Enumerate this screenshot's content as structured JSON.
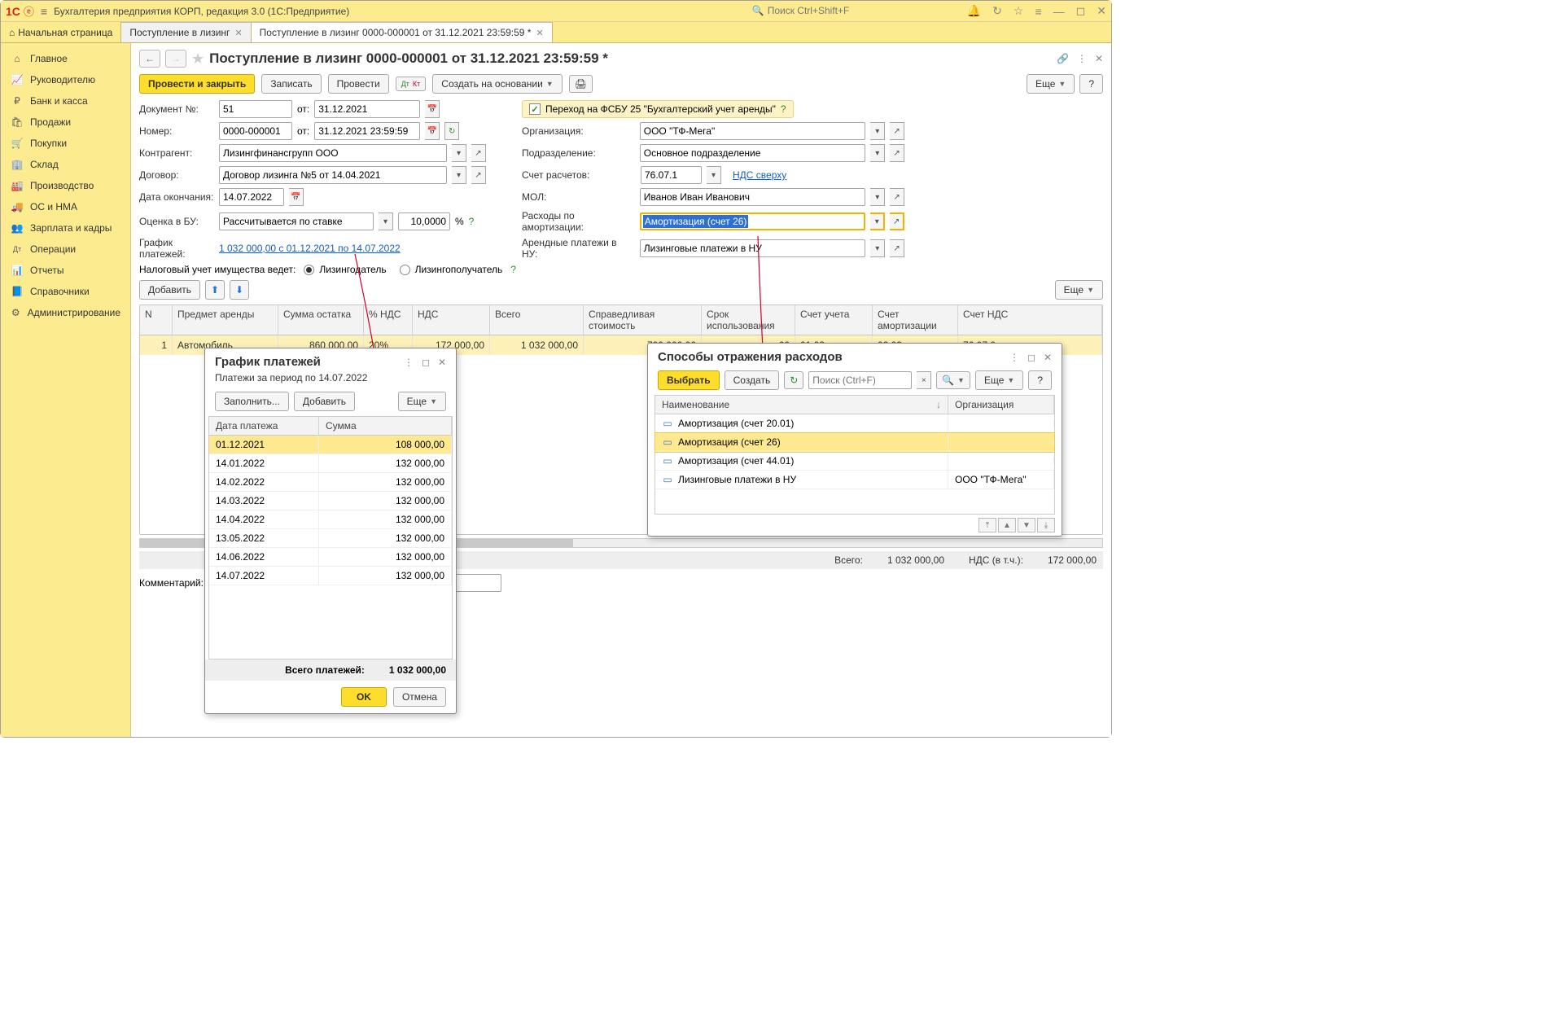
{
  "app": {
    "title": "Бухгалтерия предприятия КОРП, редакция 3.0  (1С:Предприятие)",
    "search_placeholder": "Поиск Ctrl+Shift+F"
  },
  "tabs": {
    "home": "Начальная страница",
    "t1": "Поступление в лизинг",
    "t2": "Поступление в лизинг 0000-000001 от 31.12.2021 23:59:59 *"
  },
  "sidebar": [
    {
      "icon": "⌂",
      "label": "Главное"
    },
    {
      "icon": "📈",
      "label": "Руководителю"
    },
    {
      "icon": "₽",
      "label": "Банк и касса"
    },
    {
      "icon": "🛍",
      "label": "Продажи"
    },
    {
      "icon": "🛒",
      "label": "Покупки"
    },
    {
      "icon": "🏢",
      "label": "Склад"
    },
    {
      "icon": "🏭",
      "label": "Производство"
    },
    {
      "icon": "🚚",
      "label": "ОС и НМА"
    },
    {
      "icon": "👥",
      "label": "Зарплата и кадры"
    },
    {
      "icon": "Дт",
      "label": "Операции"
    },
    {
      "icon": "📊",
      "label": "Отчеты"
    },
    {
      "icon": "📘",
      "label": "Справочники"
    },
    {
      "icon": "⚙",
      "label": "Администрирование"
    }
  ],
  "doc": {
    "title": "Поступление в лизинг 0000-000001 от 31.12.2021 23:59:59 *",
    "post_close": "Провести и закрыть",
    "save": "Записать",
    "post": "Провести",
    "create_based": "Создать на основании",
    "more": "Еще",
    "help": "?"
  },
  "fields": {
    "doc_no_lbl": "Документ №:",
    "doc_no": "51",
    "ot": "от:",
    "doc_date": "31.12.2021",
    "fsbu": "Переход на ФСБУ 25 \"Бухгалтерский учет аренды\"",
    "number_lbl": "Номер:",
    "number": "0000-000001",
    "datetime": "31.12.2021 23:59:59",
    "org_lbl": "Организация:",
    "org": "ООО \"ТФ-Мега\"",
    "contractor_lbl": "Контрагент:",
    "contractor": "Лизингфинансгрупп ООО",
    "division_lbl": "Подразделение:",
    "division": "Основное подразделение",
    "contract_lbl": "Договор:",
    "contract": "Договор лизинга №5 от 14.04.2021",
    "account_lbl": "Счет расчетов:",
    "account": "76.07.1",
    "vat_link": "НДС сверху",
    "end_date_lbl": "Дата окончания:",
    "end_date": "14.07.2022",
    "mol_lbl": "МОЛ:",
    "mol": "Иванов Иван Иванович",
    "eval_lbl": "Оценка в БУ:",
    "eval": "Рассчитывается по ставке",
    "rate": "10,0000",
    "pct": "%",
    "amort_lbl": "Расходы по амортизации:",
    "amort": "Амортизация (счет 26)",
    "schedule_lbl": "График платежей:",
    "schedule_link": "1 032 000,00 с 01.12.2021 по 14.07.2022",
    "rent_nu_lbl": "Арендные платежи в НУ:",
    "rent_nu": "Лизинговые платежи в НУ",
    "tax_account_lbl": "Налоговый учет имущества ведет:",
    "lessor": "Лизингодатель",
    "lessee": "Лизингополучатель",
    "add_btn": "Добавить",
    "comment_lbl": "Комментарий:"
  },
  "table": {
    "headers": [
      "N",
      "Предмет аренды",
      "Сумма остатка",
      "% НДС",
      "НДС",
      "Всего",
      "Справедливая стоимость",
      "Срок использования",
      "Счет учета",
      "Счет амортизации",
      "Счет НДС"
    ],
    "row": {
      "n": "1",
      "item": "Автомобиль",
      "sum": "860 000,00",
      "vat_pct": "20%",
      "vat": "172 000,00",
      "total": "1 032 000,00",
      "fair": "700 000,00",
      "term": "60",
      "acc": "01.03",
      "amort_acc": "02.03",
      "vat_acc": "76.07.9"
    }
  },
  "totals": {
    "total_lbl": "Всего:",
    "total": "1 032 000,00",
    "vat_lbl": "НДС (в т.ч.):",
    "vat": "172 000,00"
  },
  "popup1": {
    "title": "График платежей",
    "subtitle": "Платежи за период по 14.07.2022",
    "fill": "Заполнить...",
    "add": "Добавить",
    "more": "Еще",
    "h_date": "Дата платежа",
    "h_sum": "Сумма",
    "rows": [
      {
        "d": "01.12.2021",
        "s": "108 000,00"
      },
      {
        "d": "14.01.2022",
        "s": "132 000,00"
      },
      {
        "d": "14.02.2022",
        "s": "132 000,00"
      },
      {
        "d": "14.03.2022",
        "s": "132 000,00"
      },
      {
        "d": "14.04.2022",
        "s": "132 000,00"
      },
      {
        "d": "13.05.2022",
        "s": "132 000,00"
      },
      {
        "d": "14.06.2022",
        "s": "132 000,00"
      },
      {
        "d": "14.07.2022",
        "s": "132 000,00"
      }
    ],
    "total_lbl": "Всего платежей:",
    "total": "1 032 000,00",
    "ok": "OK",
    "cancel": "Отмена"
  },
  "popup2": {
    "title": "Способы отражения расходов",
    "select": "Выбрать",
    "create": "Создать",
    "more": "Еще",
    "help": "?",
    "search_ph": "Поиск (Ctrl+F)",
    "h_name": "Наименование",
    "h_org": "Организация",
    "rows": [
      {
        "n": "Амортизация (счет 20.01)",
        "o": ""
      },
      {
        "n": "Амортизация (счет 26)",
        "o": ""
      },
      {
        "n": "Амортизация (счет 44.01)",
        "o": ""
      },
      {
        "n": "Лизинговые платежи в НУ",
        "o": "ООО \"ТФ-Мега\""
      }
    ]
  }
}
